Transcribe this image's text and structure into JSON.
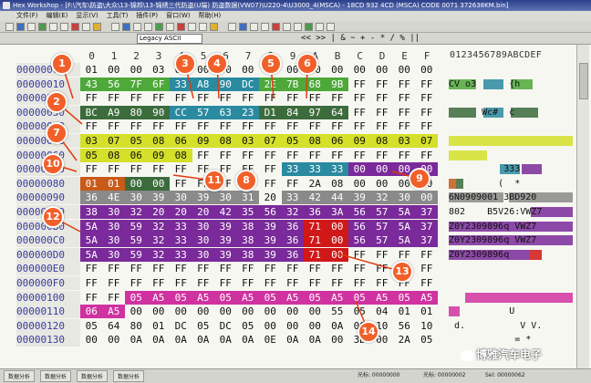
{
  "window": {
    "title": "Hex Workshop - [F:\\汽车\\防盗\\大众\\13-锦邦\\13-锦绣三代防盗(U端) 防盗数据(VW07)\\U220-4\\U3000_4(MSCA) - 18CD 932 4CD (MSCA) CODE 0071 372638KM.bin]",
    "menu": [
      "文件(F)",
      "编辑(E)",
      "显示(V)",
      "工具(T)",
      "插件(P)",
      "窗口(W)",
      "帮助(H)"
    ],
    "encoding": "Legacy ASCII",
    "ops": "<< >> | & ~ + - * / % ||"
  },
  "columns": [
    "0",
    "1",
    "2",
    "3",
    "4",
    "5",
    "6",
    "7",
    "8",
    "9",
    "A",
    "B",
    "C",
    "D",
    "E",
    "F"
  ],
  "ascii_header": "0123456789ABCDEF",
  "rows": [
    {
      "addr": "00000000",
      "bytes": [
        "01",
        "00",
        "00",
        "03",
        "01",
        "00",
        "00",
        "00",
        "00",
        "00",
        "00",
        "00",
        "00",
        "00",
        "00",
        "00"
      ],
      "ascii": ""
    },
    {
      "addr": "00000010",
      "bytes": [
        "43",
        "56",
        "7F",
        "6F",
        "33",
        "A8",
        "90",
        "DC",
        "2E",
        "7B",
        "68",
        "9B",
        "FF",
        "FF",
        "FF",
        "FF"
      ],
      "ascii": "CV o3      {h    "
    },
    {
      "addr": "00000020",
      "bytes": [
        "FF",
        "FF",
        "FF",
        "FF",
        "FF",
        "FF",
        "FF",
        "FF",
        "FF",
        "FF",
        "FF",
        "FF",
        "FF",
        "FF",
        "FF",
        "FF"
      ],
      "ascii": ""
    },
    {
      "addr": "00000030",
      "bytes": [
        "BC",
        "A9",
        "80",
        "90",
        "CC",
        "57",
        "63",
        "23",
        "D1",
        "84",
        "97",
        "64",
        "FF",
        "FF",
        "FF",
        "FF"
      ],
      "ascii": "      Wc#  c   "
    },
    {
      "addr": "00000040",
      "bytes": [
        "FF",
        "FF",
        "FF",
        "FF",
        "FF",
        "FF",
        "FF",
        "FF",
        "FF",
        "FF",
        "FF",
        "FF",
        "FF",
        "FF",
        "FF",
        "FF"
      ],
      "ascii": ""
    },
    {
      "addr": "00000050",
      "bytes": [
        "03",
        "07",
        "05",
        "08",
        "06",
        "09",
        "08",
        "03",
        "07",
        "05",
        "08",
        "06",
        "09",
        "08",
        "03",
        "07"
      ],
      "ascii": ""
    },
    {
      "addr": "00000060",
      "bytes": [
        "05",
        "08",
        "06",
        "09",
        "08",
        "FF",
        "FF",
        "FF",
        "FF",
        "FF",
        "FF",
        "FF",
        "FF",
        "FF",
        "FF",
        "FF"
      ],
      "ascii": ""
    },
    {
      "addr": "00000070",
      "bytes": [
        "FF",
        "FF",
        "FF",
        "FF",
        "FF",
        "FF",
        "FF",
        "FF",
        "FF",
        "33",
        "33",
        "33",
        "00",
        "00",
        "00",
        "00"
      ],
      "ascii": "          333   "
    },
    {
      "addr": "00000080",
      "bytes": [
        "01",
        "01",
        "00",
        "00",
        "FF",
        "FF",
        "FF",
        "FF",
        "FF",
        "FF",
        "2A",
        "08",
        "00",
        "00",
        "00",
        "00"
      ],
      "ascii": "         (  *   "
    },
    {
      "addr": "00000090",
      "bytes": [
        "36",
        "4E",
        "30",
        "39",
        "30",
        "39",
        "30",
        "31",
        "20",
        "33",
        "42",
        "44",
        "39",
        "32",
        "30",
        "00"
      ],
      "ascii": "6N0909001 3BD920"
    },
    {
      "addr": "000000A0",
      "bytes": [
        "38",
        "30",
        "32",
        "20",
        "20",
        "20",
        "42",
        "35",
        "56",
        "32",
        "36",
        "3A",
        "56",
        "57",
        "5A",
        "37"
      ],
      "ascii": "802    B5V26:VWZ7"
    },
    {
      "addr": "000000B0",
      "bytes": [
        "5A",
        "30",
        "59",
        "32",
        "33",
        "30",
        "39",
        "38",
        "39",
        "36",
        "71",
        "00",
        "56",
        "57",
        "5A",
        "37"
      ],
      "ascii": "Z0Y2309896q VWZ7"
    },
    {
      "addr": "000000C0",
      "bytes": [
        "5A",
        "30",
        "59",
        "32",
        "33",
        "30",
        "39",
        "38",
        "39",
        "36",
        "71",
        "00",
        "56",
        "57",
        "5A",
        "37"
      ],
      "ascii": "Z0Y2309896q VWZ7"
    },
    {
      "addr": "000000D0",
      "bytes": [
        "5A",
        "30",
        "59",
        "32",
        "33",
        "30",
        "39",
        "38",
        "39",
        "36",
        "71",
        "00",
        "FF",
        "FF",
        "FF",
        "FF"
      ],
      "ascii": "Z0Y2309896q     "
    },
    {
      "addr": "000000E0",
      "bytes": [
        "FF",
        "FF",
        "FF",
        "FF",
        "FF",
        "FF",
        "FF",
        "FF",
        "FF",
        "FF",
        "FF",
        "FF",
        "FF",
        "FF",
        "FF",
        "FF"
      ],
      "ascii": ""
    },
    {
      "addr": "000000F0",
      "bytes": [
        "FF",
        "FF",
        "FF",
        "FF",
        "FF",
        "FF",
        "FF",
        "FF",
        "FF",
        "FF",
        "FF",
        "FF",
        "FF",
        "FF",
        "FF",
        "FF"
      ],
      "ascii": ""
    },
    {
      "addr": "00000100",
      "bytes": [
        "FF",
        "FF",
        "05",
        "A5",
        "05",
        "A5",
        "05",
        "A5",
        "05",
        "A5",
        "05",
        "A5",
        "05",
        "A5",
        "05",
        "A5"
      ],
      "ascii": ""
    },
    {
      "addr": "00000110",
      "bytes": [
        "06",
        "A5",
        "00",
        "00",
        "00",
        "00",
        "00",
        "00",
        "00",
        "00",
        "00",
        "55",
        "05",
        "04",
        "01",
        "01"
      ],
      "ascii": "           U    "
    },
    {
      "addr": "00000120",
      "bytes": [
        "05",
        "64",
        "80",
        "01",
        "DC",
        "05",
        "DC",
        "05",
        "00",
        "00",
        "00",
        "0A",
        "00",
        "10",
        "56",
        "10"
      ],
      "ascii": " d.          V V."
    },
    {
      "addr": "00000130",
      "bytes": [
        "00",
        "00",
        "0A",
        "0A",
        "0A",
        "0A",
        "0A",
        "0A",
        "0E",
        "0A",
        "0A",
        "00",
        "3D",
        "00",
        "2A",
        "05"
      ],
      "ascii": "            = *"
    }
  ],
  "status": {
    "tabs": [
      "数据分析",
      "数据分析",
      "数据分析",
      "数据分析"
    ],
    "cursor": "光标: 00000000",
    "caret": "光标: 00000002",
    "sel": "Sel: 00000062",
    "size": "Size: 00000000"
  },
  "watermark": "博雅汽车电子",
  "callouts": [
    "1",
    "2",
    "3",
    "4",
    "5",
    "6",
    "7",
    "8",
    "9",
    "10",
    "11",
    "12",
    "13",
    "14"
  ],
  "colors": {
    "green": "#4ea83a",
    "teal": "#2a8aa0",
    "darkgreen": "#3c6b3c",
    "yellow": "#d4e02a",
    "purple": "#7a2a9a",
    "gray": "#8a8a8a",
    "red": "#d01818",
    "orange": "#c85a1a",
    "pink": "#d032a0",
    "badge": "#f2602a"
  }
}
